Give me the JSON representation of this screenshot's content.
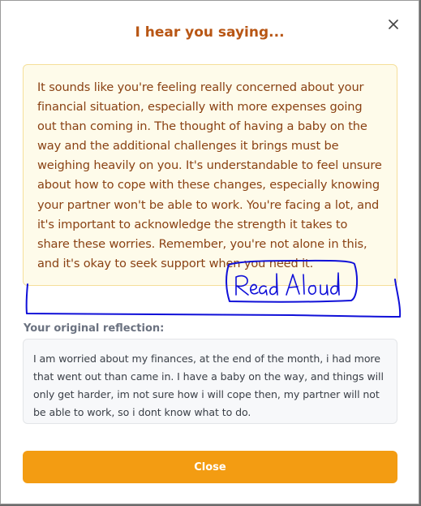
{
  "dialog": {
    "title": "I hear you saying...",
    "close_icon": "close-icon",
    "accent_color": "#f39c12",
    "title_color": "#b85614"
  },
  "response": {
    "text": "It sounds like you're feeling really concerned about your financial situation, especially with more expenses going out than coming in. The thought of having a baby on the way and the additional challenges it brings must be weighing heavily on you. It's understandable to feel unsure about how to cope with these changes, especially knowing your partner won't be able to work. You're facing a lot, and it's important to acknowledge the strength it takes to share these worries. Remember, you're not alone in this, and it's okay to seek support when you need it."
  },
  "annotation": {
    "handwritten_label": "Read Aloud",
    "ink_color": "#1010d8"
  },
  "original": {
    "label": "Your original reflection:",
    "text": "I am worried about my finances, at the end of the month, i had more that went out than came in. I have a baby on the way, and things will only get harder, im not sure how i will cope then, my partner will not be able to work, so i dont know what to do."
  },
  "actions": {
    "close_label": "Close"
  }
}
